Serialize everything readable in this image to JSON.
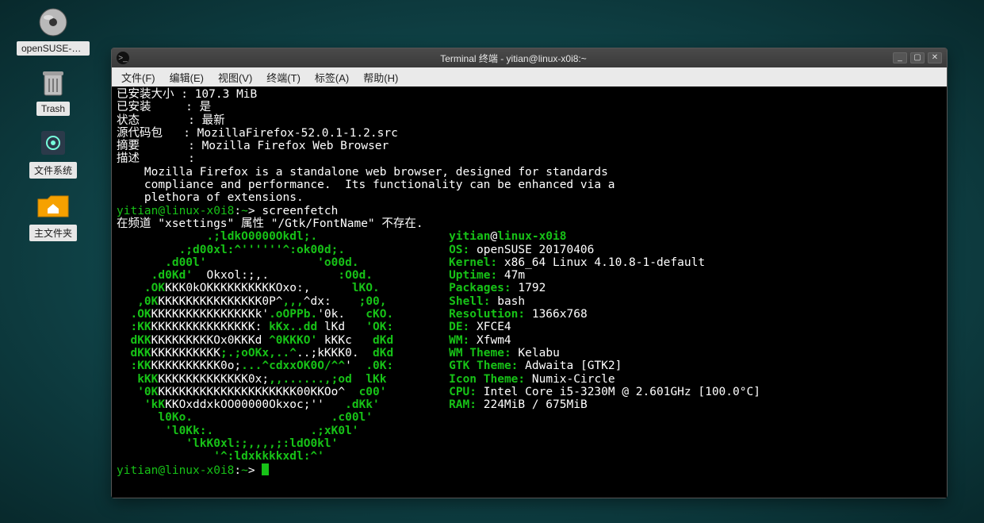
{
  "desktop": {
    "icons": [
      {
        "name": "opensuse-disc",
        "label": "openSUSE-T…"
      },
      {
        "name": "trash",
        "label": "Trash"
      },
      {
        "name": "filesystem",
        "label": "文件系统"
      },
      {
        "name": "home-folder",
        "label": "主文件夹"
      }
    ]
  },
  "window": {
    "title": "Terminal 终端 - yitian@linux-x0i8:~",
    "menus": [
      "文件(F)",
      "编辑(E)",
      "视图(V)",
      "终端(T)",
      "标签(A)",
      "帮助(H)"
    ],
    "controls": {
      "min": "_",
      "max": "▢",
      "close": "✕"
    }
  },
  "pkg_info": {
    "installed_size_label": "已安装大小 ",
    "installed_size_value": "107.3 MiB",
    "installed_label": "已安装     ",
    "installed_value": "是",
    "state_label": "状态       ",
    "state_value": "最新",
    "srcpkg_label": "源代码包   ",
    "srcpkg_value": "MozillaFirefox-52.0.1-1.2.src",
    "summary_label": "摘要       ",
    "summary_value": "Mozilla Firefox Web Browser",
    "desc_label": "描述       ",
    "desc_lines": [
      "Mozilla Firefox is a standalone web browser, designed for standards",
      "compliance and performance.  Its functionality can be enhanced via a",
      "plethora of extensions."
    ]
  },
  "prompt": {
    "user_host": "yitian@linux-x0i8",
    "path": "~",
    "sep": ":",
    "marker": "> ",
    "cmd": "screenfetch"
  },
  "warn_line": "在频道 \"xsettings\" 属性 \"/Gtk/FontName\" 不存在.",
  "screenfetch": {
    "user": "yitian",
    "host": "linux-x0i8",
    "labels": {
      "os": "OS:",
      "kernel": "Kernel:",
      "uptime": "Uptime:",
      "packages": "Packages:",
      "shell": "Shell:",
      "resolution": "Resolution:",
      "de": "DE:",
      "wm": "WM:",
      "wmtheme": "WM Theme:",
      "gtktheme": "GTK Theme:",
      "icontheme": "Icon Theme:",
      "cpu": "CPU:",
      "ram": "RAM:"
    },
    "values": {
      "os": "openSUSE 20170406",
      "kernel": "x86_64 Linux 4.10.8-1-default",
      "uptime": "47m",
      "packages": "1792",
      "shell": "bash",
      "resolution": "1366x768",
      "de": "XFCE4",
      "wm": "Xfwm4",
      "wmtheme": "Kelabu",
      "gtktheme": "Adwaita [GTK2]",
      "icontheme": "Numix-Circle",
      "cpu": "Intel Core i5-3230M @ 2.601GHz [100.0°C]",
      "ram": "224MiB / 675MiB"
    },
    "ascii": [
      {
        "pre": "             ",
        "g": ".;ldkO0000Okdl;.",
        "post": "             "
      },
      {
        "pre": "         ",
        "g": ".;d00xl:^''''''^:ok00d;.",
        "post": "         "
      },
      {
        "pre": "       ",
        "g": ".d00l'                'o00d.",
        "post": "       "
      },
      {
        "pre": "     ",
        "g": ".d0Kd'",
        "mid": "  Okxol:;,.          ",
        "g2": ":O0d.",
        "post": "     "
      },
      {
        "pre": "    ",
        "g": ".OK",
        "mid": "KKK0kOKKKKKKKKKKOxo:,      ",
        "g2": "lKO.",
        "post": "    "
      },
      {
        "pre": "   ",
        "g": ",0K",
        "mid": "KKKKKKKKKKKKKKK0P^",
        "g2": ",,,",
        "mid2": "^dx:",
        "g3": "    ;00,",
        "post": "   "
      },
      {
        "pre": "  ",
        "g": ".OK",
        "mid": "KKKKKKKKKKKKKKKk'",
        "g2": ".oOPPb.",
        "mid2": "'0k.   ",
        "g3": "cKO.",
        "post": "  "
      },
      {
        "pre": "  ",
        "g": ":KK",
        "mid": "KKKKKKKKKKKKKKK: ",
        "g2": "kKx..dd ",
        "mid2": "lKd",
        "g3": "   'OK:",
        "post": "  "
      },
      {
        "pre": "  ",
        "g": "dKK",
        "mid": "KKKKKKKKKOx0KKKd ",
        "g2": "^0KKKO' ",
        "mid2": "kKKc",
        "g3": "   dKd",
        "post": "  "
      },
      {
        "pre": "  ",
        "g": "dKK",
        "mid": "KKKKKKKKKK",
        "g2": ";.;oOKx,..^",
        "mid2": "..;kKKK0.",
        "g3": "  dKd",
        "post": "  "
      },
      {
        "pre": "  ",
        "g": ":KK",
        "mid": "KKKKKKKKKK0o;",
        "g2": "...^cdxxOK0O/^^",
        "mid2": "'  ",
        "g3": ".0K:",
        "post": "  "
      },
      {
        "pre": "   ",
        "g": "kKK",
        "mid": "KKKKKKKKKKKKK0x;",
        "g2": ",,......,;od  ",
        "mid2": "",
        "g3": "lKk",
        "post": "   "
      },
      {
        "pre": "   ",
        "g": "'0K",
        "mid": "KKKKKKKKKKKKKKKKKKKK00KKOo^",
        "g2": "",
        "mid2": "  ",
        "g3": "c00'",
        "post": "   "
      },
      {
        "pre": "    ",
        "g": "'kK",
        "mid": "KKOxddxkOO00000Okxoc;''   ",
        "g2": "",
        "mid2": "",
        "g3": ".dKk'",
        "post": "    "
      },
      {
        "pre": "      ",
        "g": "l0Ko.                    .c00l'",
        "post": ""
      },
      {
        "pre": "       ",
        "g": "'l0Kk:.              .;xK0l'",
        "post": ""
      },
      {
        "pre": "          ",
        "g": "'lkK0xl:;,,,,;:ldO0kl'",
        "post": ""
      },
      {
        "pre": "              ",
        "g": "'^:ldxkkkkxdl:^'",
        "post": ""
      }
    ]
  }
}
